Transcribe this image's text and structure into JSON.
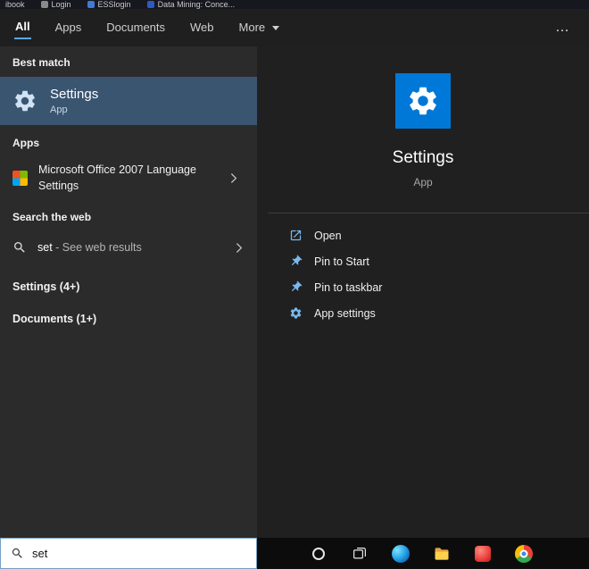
{
  "browser": {
    "bookmarks": [
      "ibook",
      "Login",
      "ESSlogin",
      "Data Mining: Conce..."
    ]
  },
  "search_flyout": {
    "tabs": [
      {
        "label": "All",
        "active": true
      },
      {
        "label": "Apps",
        "active": false
      },
      {
        "label": "Documents",
        "active": false
      },
      {
        "label": "Web",
        "active": false
      },
      {
        "label": "More",
        "active": false,
        "has_dropdown": true
      }
    ],
    "overflow_button": "…",
    "left_panel": {
      "best_match_header": "Best match",
      "best_match": {
        "title": "Settings",
        "subtitle": "App"
      },
      "apps_header": "Apps",
      "apps": [
        {
          "title": "Microsoft Office 2007 Language Settings"
        }
      ],
      "web_header": "Search the web",
      "web_results": [
        {
          "query": "set",
          "suffix": " - See web results"
        }
      ],
      "groups": [
        {
          "label": "Settings (4+)"
        },
        {
          "label": "Documents (1+)"
        }
      ]
    },
    "preview_panel": {
      "app_name": "Settings",
      "app_type": "App",
      "actions": [
        {
          "label": "Open",
          "icon": "open-icon"
        },
        {
          "label": "Pin to Start",
          "icon": "pin-icon"
        },
        {
          "label": "Pin to taskbar",
          "icon": "pin-icon"
        },
        {
          "label": "App settings",
          "icon": "gear-icon"
        }
      ]
    }
  },
  "taskbar": {
    "search_value": "set",
    "icons": [
      "cortana-icon",
      "task-view-icon",
      "edge-icon",
      "file-explorer-icon",
      "pinned-app-icon",
      "chrome-icon"
    ]
  },
  "colors": {
    "accent_tile_blue": "#0078d7",
    "tab_underline_blue": "#5ba7e0",
    "best_match_highlight": "#3a5570",
    "action_icon_blue": "#78b9ef",
    "left_panel_bg": "#2b2b2b",
    "right_panel_bg": "#202020",
    "taskbar_bg": "#0c0c0c"
  }
}
